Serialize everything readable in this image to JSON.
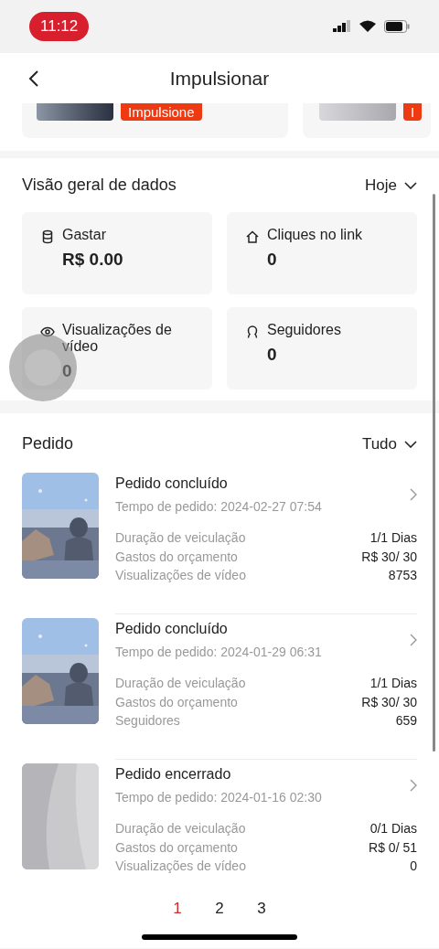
{
  "status_bar": {
    "time": "11:12"
  },
  "header": {
    "title": "Impulsionar"
  },
  "carousel": [
    {
      "button": "Impulsione"
    },
    {
      "button": "I"
    }
  ],
  "overview": {
    "title": "Visão geral de dados",
    "filter": "Hoje",
    "metrics": [
      {
        "kind": "database",
        "label": "Gastar",
        "value": "R$ 0.00"
      },
      {
        "kind": "home",
        "label": "Cliques no link",
        "value": "0"
      },
      {
        "kind": "eye",
        "label": "Visualizações de vídeo",
        "value": "0"
      },
      {
        "kind": "person",
        "label": "Seguidores",
        "value": "0"
      }
    ]
  },
  "orders": {
    "title": "Pedido",
    "filter": "Tudo",
    "items": [
      {
        "status": "Pedido concluído",
        "time": "Tempo de pedido: 2024-02-27 07:54",
        "rows": [
          {
            "label": "Duração de veiculação",
            "value": "1/1 Dias"
          },
          {
            "label": "Gastos do orçamento",
            "value": "R$ 30/ 30"
          },
          {
            "label": "Visualizações de vídeo",
            "value": "8753"
          }
        ]
      },
      {
        "status": "Pedido concluído",
        "time": "Tempo de pedido: 2024-01-29 06:31",
        "rows": [
          {
            "label": "Duração de veiculação",
            "value": "1/1 Dias"
          },
          {
            "label": "Gastos do orçamento",
            "value": "R$ 30/ 30"
          },
          {
            "label": "Seguidores",
            "value": "659"
          }
        ]
      },
      {
        "kind": "blank",
        "status": "Pedido encerrado",
        "time": "Tempo de pedido: 2024-01-16 02:30",
        "rows": [
          {
            "label": "Duração de veiculação",
            "value": "0/1 Dias"
          },
          {
            "label": "Gastos do orçamento",
            "value": "R$ 0/ 51"
          },
          {
            "label": "Visualizações de vídeo",
            "value": "0"
          }
        ]
      }
    ]
  },
  "pagination": [
    {
      "label": "1",
      "selected": true
    },
    {
      "label": "2",
      "selected": false
    },
    {
      "label": "3",
      "selected": false
    }
  ]
}
